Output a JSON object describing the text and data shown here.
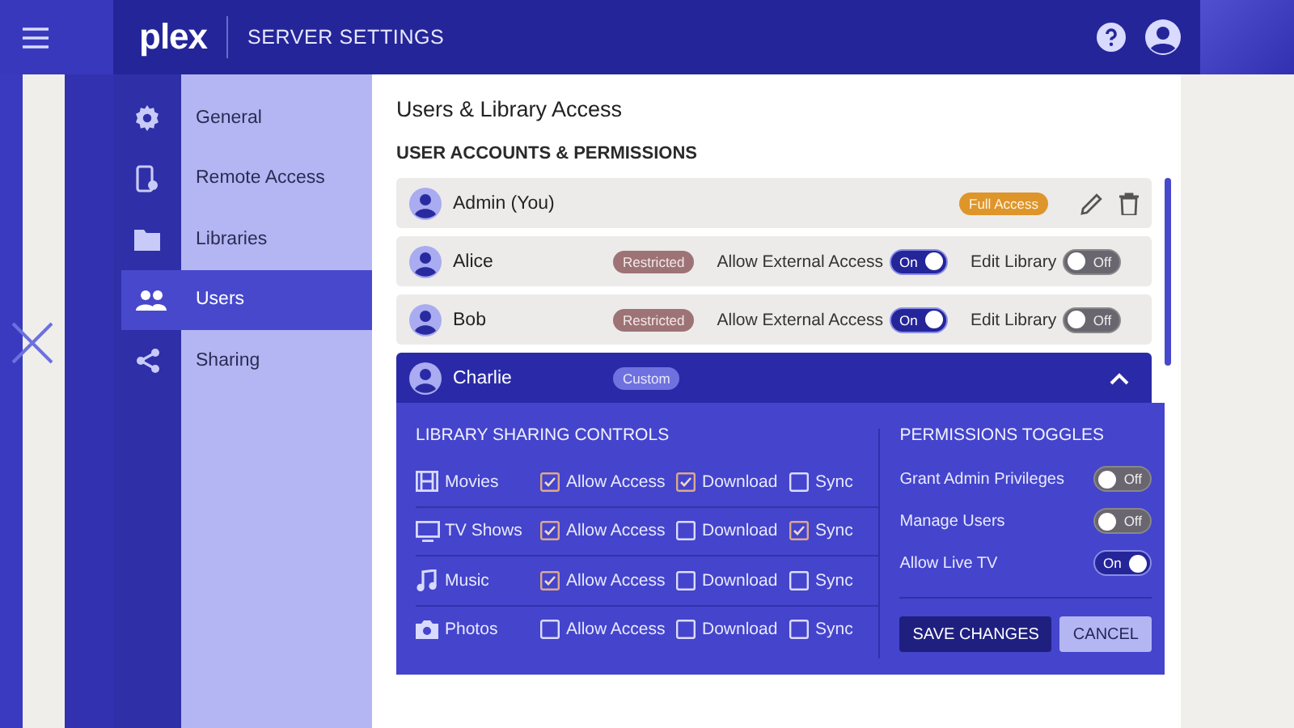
{
  "header": {
    "logo": "plex",
    "title": "SERVER SETTINGS"
  },
  "sidebar": {
    "items": [
      {
        "label": "General",
        "selected": false
      },
      {
        "label": "Remote Access",
        "selected": false
      },
      {
        "label": "Libraries",
        "selected": false
      },
      {
        "label": "Users",
        "selected": true
      },
      {
        "label": "Sharing",
        "selected": false
      }
    ]
  },
  "page": {
    "title": "Users & Library Access",
    "section": "USER ACCOUNTS & PERMISSIONS"
  },
  "users": [
    {
      "name": "Admin (You)",
      "badge": {
        "label": "Full Access",
        "kind": "full"
      },
      "expanded": false,
      "kind": "owner"
    },
    {
      "name": "Alice",
      "badge": {
        "label": "Restricted",
        "kind": "restricted"
      },
      "expanded": false,
      "toggles": [
        {
          "label": "Allow External Access",
          "on": true,
          "text": "On"
        },
        {
          "label": "Edit Library",
          "on": false,
          "text": "Off"
        }
      ]
    },
    {
      "name": "Bob",
      "badge": {
        "label": "Restricted",
        "kind": "restricted"
      },
      "expanded": false,
      "toggles": [
        {
          "label": "Allow External Access",
          "on": true,
          "text": "On"
        },
        {
          "label": "Edit Library",
          "on": false,
          "text": "Off"
        }
      ]
    },
    {
      "name": "Charlie",
      "badge": {
        "label": "Custom",
        "kind": "custom"
      },
      "expanded": true
    }
  ],
  "details": {
    "library_title": "LIBRARY SHARING CONTROLS",
    "libraries": [
      {
        "name": "Movies",
        "options": [
          {
            "label": "Allow Access",
            "checked": true
          },
          {
            "label": "Download",
            "checked": true
          },
          {
            "label": "Sync",
            "checked": false
          }
        ]
      },
      {
        "name": "TV Shows",
        "options": [
          {
            "label": "Allow Access",
            "checked": true
          },
          {
            "label": "Download",
            "checked": false
          },
          {
            "label": "Sync",
            "checked": true
          }
        ]
      },
      {
        "name": "Music",
        "options": [
          {
            "label": "Allow Access",
            "checked": true
          },
          {
            "label": "Download",
            "checked": false
          },
          {
            "label": "Sync",
            "checked": false
          }
        ]
      },
      {
        "name": "Photos",
        "options": [
          {
            "label": "Allow Access",
            "checked": false
          },
          {
            "label": "Download",
            "checked": false
          },
          {
            "label": "Sync",
            "checked": false
          }
        ]
      }
    ],
    "permissions_title": "PERMISSIONS TOGGLES",
    "permissions": [
      {
        "label": "Grant Admin Privileges",
        "on": false,
        "text": "Off"
      },
      {
        "label": "Manage Users",
        "on": false,
        "text": "Off"
      },
      {
        "label": "Allow Live TV",
        "on": true,
        "text": "On"
      }
    ],
    "buttons": [
      {
        "label": "SAVE CHANGES",
        "kind": "primary"
      },
      {
        "label": "CANCEL",
        "kind": "secondary"
      }
    ]
  }
}
